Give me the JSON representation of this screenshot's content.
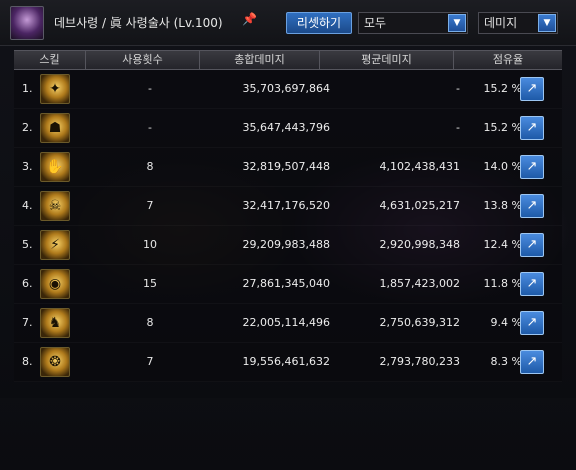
{
  "header": {
    "title": "데브사령 / 眞 사령술사 (Lv.100)",
    "reset_label": "리셋하기",
    "filter_select": "모두",
    "metric_select": "데미지"
  },
  "table": {
    "columns": [
      "스킬",
      "사용횟수",
      "총합데미지",
      "평균데미지",
      "점유율"
    ],
    "rows": [
      {
        "rank": "1.",
        "uses": "-",
        "total": "35,703,697,864",
        "avg": "-",
        "share": "15.2 %"
      },
      {
        "rank": "2.",
        "uses": "-",
        "total": "35,647,443,796",
        "avg": "-",
        "share": "15.2 %"
      },
      {
        "rank": "3.",
        "uses": "8",
        "total": "32,819,507,448",
        "avg": "4,102,438,431",
        "share": "14.0 %"
      },
      {
        "rank": "4.",
        "uses": "7",
        "total": "32,417,176,520",
        "avg": "4,631,025,217",
        "share": "13.8 %"
      },
      {
        "rank": "5.",
        "uses": "10",
        "total": "29,209,983,488",
        "avg": "2,920,998,348",
        "share": "12.4 %"
      },
      {
        "rank": "6.",
        "uses": "15",
        "total": "27,861,345,040",
        "avg": "1,857,423,002",
        "share": "11.8 %"
      },
      {
        "rank": "7.",
        "uses": "8",
        "total": "22,005,114,496",
        "avg": "2,750,639,312",
        "share": "9.4 %"
      },
      {
        "rank": "8.",
        "uses": "7",
        "total": "19,556,461,632",
        "avg": "2,793,780,233",
        "share": "8.3 %"
      }
    ]
  }
}
